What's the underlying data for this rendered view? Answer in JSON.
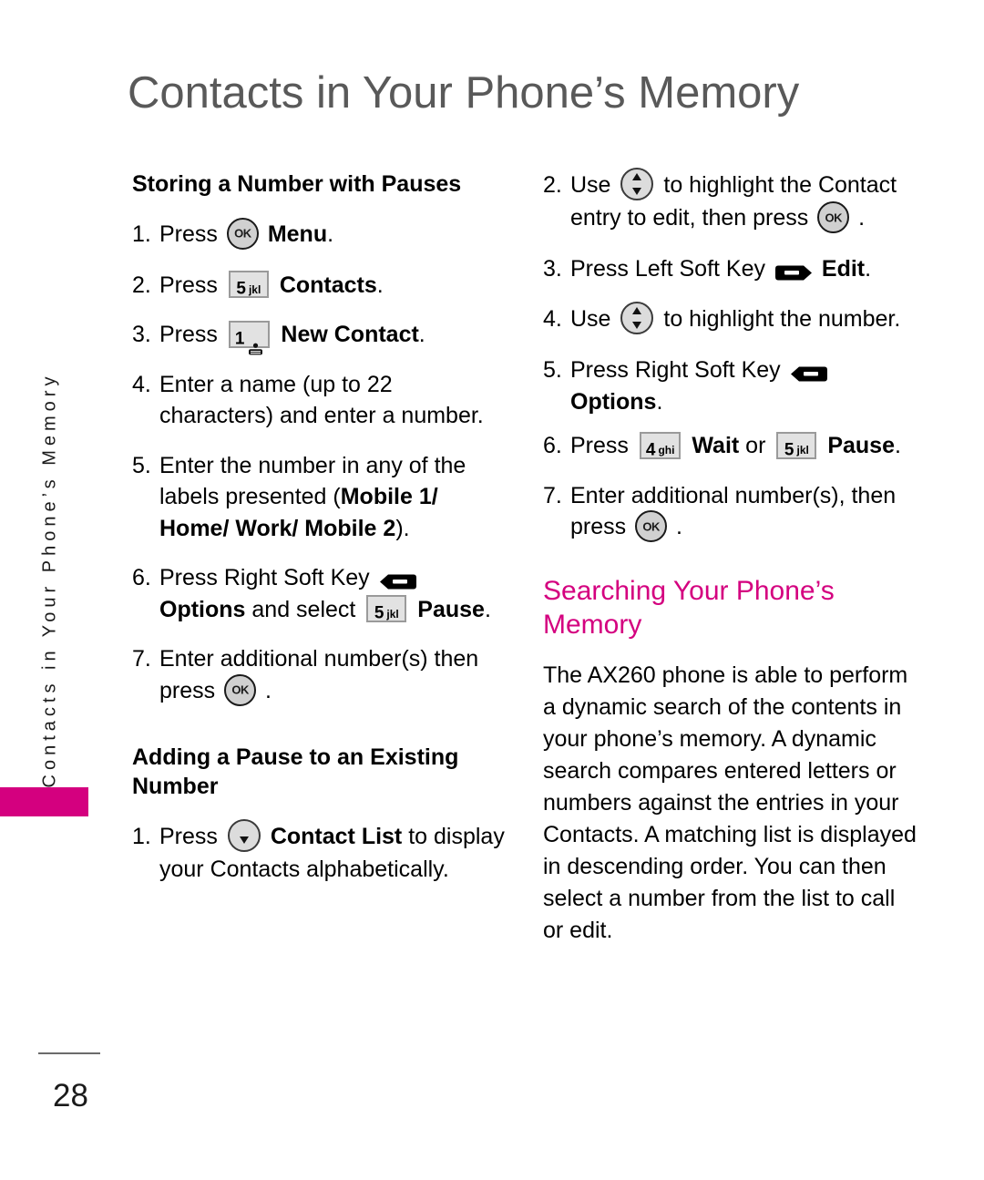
{
  "page": {
    "title": "Contacts in Your Phone’s Memory",
    "number": "28",
    "side_tab_text": "Contacts in Your Phone’s Memory",
    "accent_color": "#d4007f",
    "title_color": "#595959"
  },
  "left_column": {
    "section1": {
      "heading": "Storing a Number with Pauses",
      "steps": [
        {
          "num": "1.",
          "pre": "Press",
          "icon": "ok-key-icon",
          "post_bold": "Menu",
          "post": "."
        },
        {
          "num": "2.",
          "pre": "Press",
          "icon": "keypad-5-jkl-icon",
          "post_bold": "Contacts",
          "post": "."
        },
        {
          "num": "3.",
          "pre": "Press",
          "icon": "keypad-1-voicemail-icon",
          "post_bold": "New Contact",
          "post": "."
        },
        {
          "num": "4.",
          "text": "Enter a name (up to 22 characters) and enter a number."
        },
        {
          "num": "5.",
          "text_a": "Enter the number in any of the labels presented (",
          "text_bold": "Mobile 1/ Home/ Work/ Mobile 2",
          "text_b": ")."
        },
        {
          "num": "6.",
          "pre": "Press Right Soft Key",
          "icon": "right-soft-key-icon",
          "mid_bold": "Options",
          "mid": " and select",
          "icon2": "keypad-5-jkl-icon",
          "post_bold": "Pause",
          "post": "."
        },
        {
          "num": "7.",
          "pre": "Enter additional number(s) then press",
          "icon": "ok-key-icon",
          "post": "."
        }
      ]
    },
    "section2": {
      "heading": "Adding a Pause to an Existing Number",
      "steps": [
        {
          "num": "1.",
          "pre": "Press",
          "icon": "nav-down-key-icon",
          "mid_bold": "Contact List",
          "post": " to display your Contacts alphabetically."
        }
      ]
    }
  },
  "right_column": {
    "steps": [
      {
        "num": "2.",
        "pre": "Use",
        "icon": "nav-updown-key-icon",
        "mid": "to highlight the Contact entry to edit, then press",
        "icon2": "ok-key-icon",
        "post": "."
      },
      {
        "num": "3.",
        "pre": "Press Left Soft Key",
        "icon": "left-soft-key-icon",
        "post_bold": "Edit",
        "post": "."
      },
      {
        "num": "4.",
        "pre": "Use",
        "icon": "nav-updown-key-icon",
        "mid": "to highlight the number."
      },
      {
        "num": "5.",
        "pre": "Press Right Soft Key",
        "icon": "right-soft-key-icon",
        "post_bold": "Options",
        "post": "."
      },
      {
        "num": "6.",
        "pre": "Press",
        "icon": "keypad-4-ghi-icon",
        "mid_bold": "Wait",
        "mid": " or",
        "icon2": "keypad-5-jkl-icon",
        "post_bold": "Pause",
        "post": "."
      },
      {
        "num": "7.",
        "pre": "Enter additional number(s), then press",
        "icon": "ok-key-icon",
        "post": "."
      }
    ],
    "section": {
      "heading": "Searching Your Phone’s Memory",
      "paragraph": "The AX260 phone is able to perform a dynamic search of the contents in your phone’s memory. A dynamic search compares entered letters or numbers against the entries in your Contacts. A matching list is displayed in descending order. You can then select a number from the list to call or edit."
    }
  },
  "keys": {
    "k5": {
      "digit": "5",
      "letters": "jkl"
    },
    "k4": {
      "digit": "4",
      "letters": "ghi"
    },
    "k1": {
      "digit": "1",
      "letters": ""
    }
  }
}
